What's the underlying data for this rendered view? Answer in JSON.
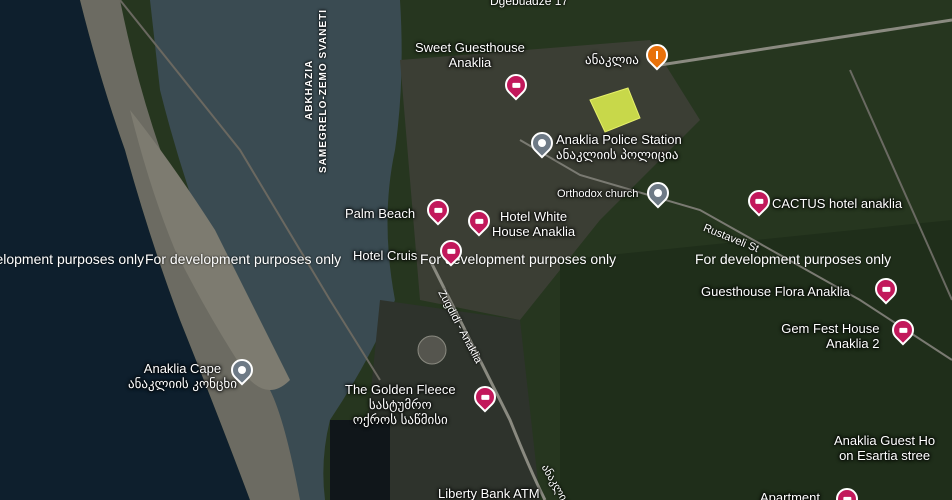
{
  "map": {
    "watermark": "For development purposes only",
    "admin_labels": [
      "ABKHAZIA",
      "SAMEGRELO-ZEMO SVANETI"
    ],
    "streets": {
      "top": "Dgebuadze 17",
      "rustaveli": "Rustaveli St",
      "zugdidi": "Zugdidi - Anaklia",
      "bottom_road": "ანაკლია"
    },
    "places": {
      "sweet_guesthouse": [
        "Sweet Guesthouse",
        "Anaklia"
      ],
      "anaklia_local": "ანაკლია",
      "police": [
        "Anaklia Police Station",
        "ანაკლიის პოლიცია"
      ],
      "orthodox": "Orthodox church",
      "cactus": "CACTUS hotel anaklia",
      "palm_beach": "Palm Beach",
      "white_house": [
        "Hotel White",
        "House Anaklia"
      ],
      "hotel_cruise": "Hotel Cruis",
      "flora": "Guesthouse Flora Anaklia",
      "gem_fest": [
        "Gem Fest House",
        "Anaklia 2"
      ],
      "cape": [
        "Anaklia Cape",
        "ანაკლიის კონცხი"
      ],
      "golden_fleece": [
        "The Golden Fleece",
        "სასტუმრო",
        "ოქროს საწმისი"
      ],
      "guest_esartia": [
        "Anaklia Guest Ho",
        "on Esartia stree"
      ],
      "liberty": "Liberty Bank ATM",
      "apartment": "Apartment"
    },
    "colors": {
      "sea": "#0e1f2d",
      "river": "#3a4a50",
      "sand": "#6e6d62",
      "land": "#24331f",
      "hotel_pin": "#c2185b",
      "highlight": "#c8d84a"
    }
  }
}
